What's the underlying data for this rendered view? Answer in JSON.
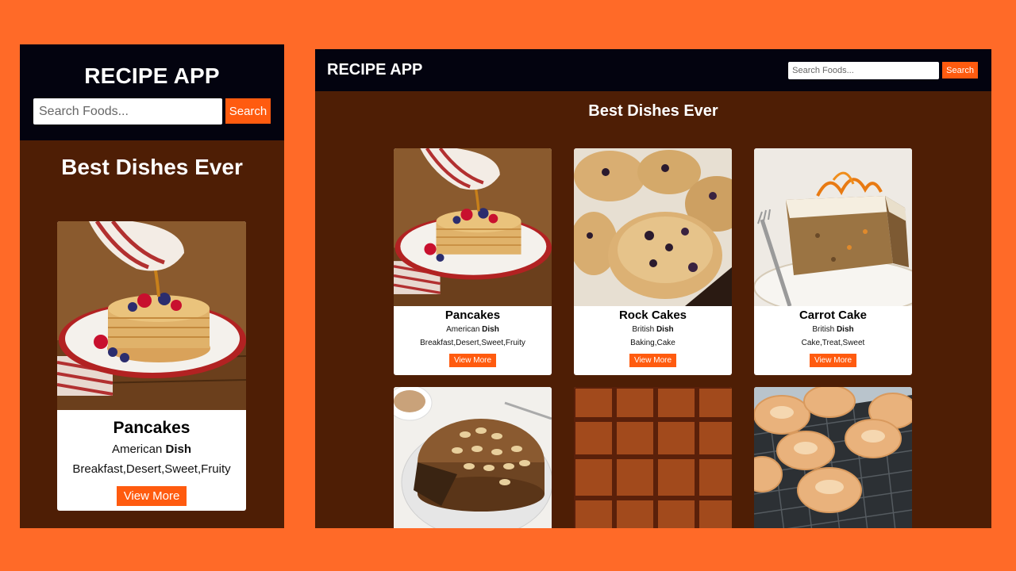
{
  "mobile": {
    "app_title": "RECIPE APP",
    "search": {
      "placeholder": "Search Foods...",
      "button_label": "Search"
    },
    "section_title": "Best Dishes Ever",
    "card": {
      "name": "Pancakes",
      "area": "American",
      "dish_word": "Dish",
      "tags": "Breakfast,Desert,Sweet,Fruity",
      "button_label": "View More"
    }
  },
  "desktop": {
    "app_title": "RECIPE APP",
    "search": {
      "placeholder": "Search Foods...",
      "button_label": "Search"
    },
    "section_title": "Best Dishes Ever",
    "cards": [
      {
        "name": "Pancakes",
        "area": "American",
        "dish_word": "Dish",
        "tags": "Breakfast,Desert,Sweet,Fruity",
        "button_label": "View More"
      },
      {
        "name": "Rock Cakes",
        "area": "British",
        "dish_word": "Dish",
        "tags": "Baking,Cake",
        "button_label": "View More"
      },
      {
        "name": "Carrot Cake",
        "area": "British",
        "dish_word": "Dish",
        "tags": "Cake,Treat,Sweet",
        "button_label": "View More"
      }
    ]
  },
  "colors": {
    "background": "#ff6a28",
    "header": "#03030f",
    "content": "#4e1e05",
    "accent": "#ff5b0f"
  }
}
